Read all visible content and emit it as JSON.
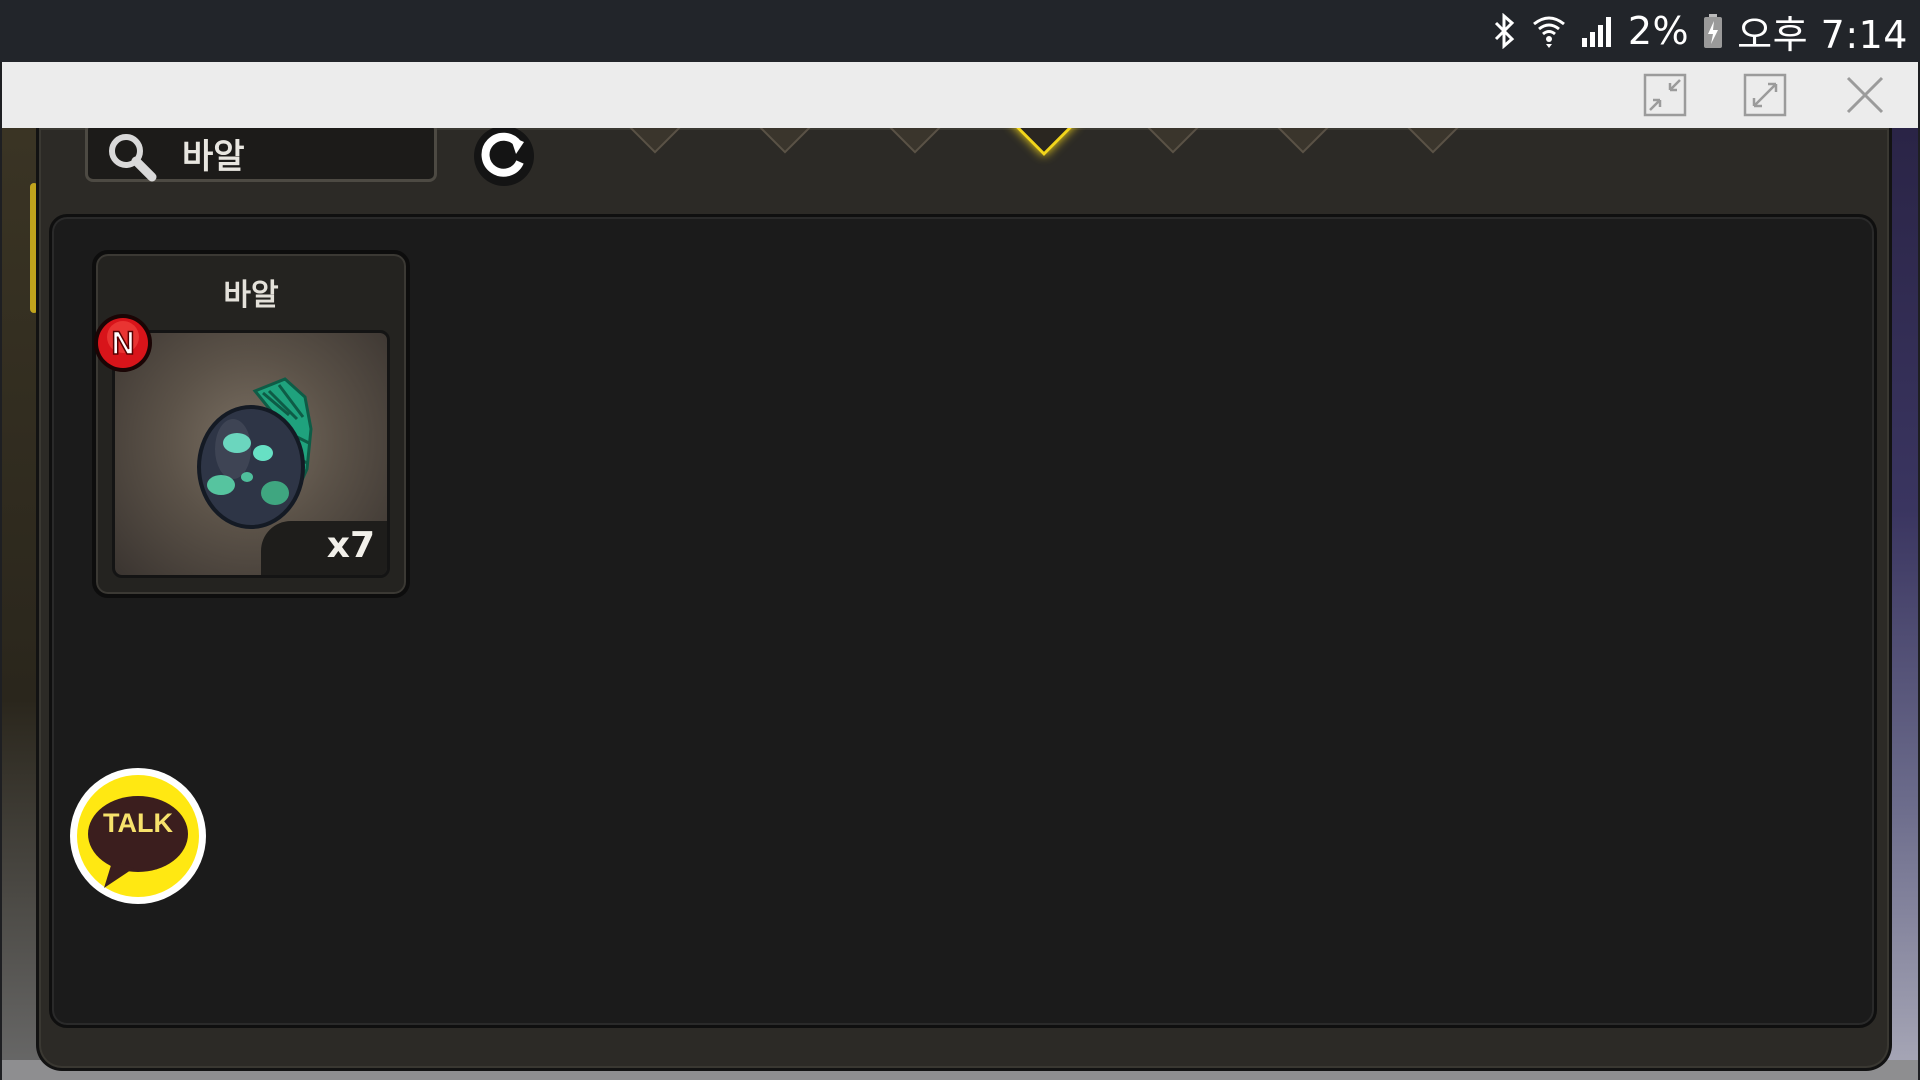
{
  "status_bar": {
    "battery_percent": "2%",
    "time": "오후 7:14",
    "icons": [
      "bluetooth-icon",
      "wifi-icon",
      "signal-icon",
      "battery-charging-icon"
    ]
  },
  "window_controls": {
    "icons": [
      "minimize-icon",
      "maximize-icon",
      "close-icon"
    ]
  },
  "search": {
    "value": "바알",
    "icon": "search-icon"
  },
  "refresh": {
    "icon": "refresh-icon"
  },
  "categories": {
    "count": 7,
    "active_index": 3
  },
  "items": [
    {
      "name": "바알",
      "quantity": "x7",
      "badge": "N",
      "icon": "dragon-egg-icon"
    }
  ],
  "talk_button": {
    "label": "TALK"
  },
  "colors": {
    "active_tab": "#f2d51b",
    "new_badge": "#d8141a",
    "talk_yellow": "#ffe812"
  }
}
